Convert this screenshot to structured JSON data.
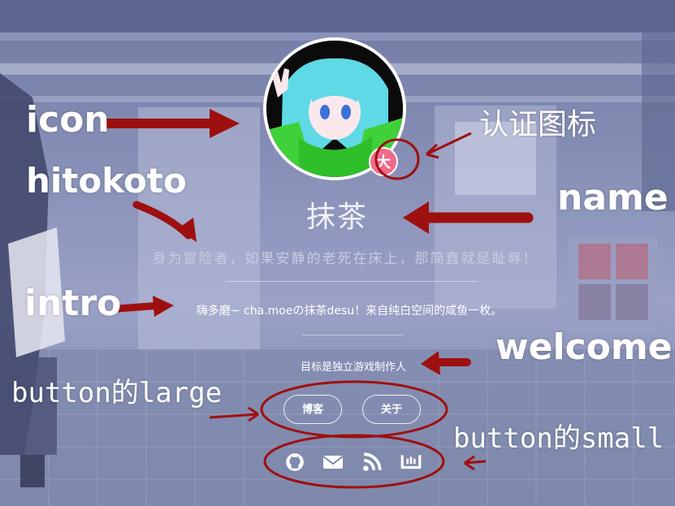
{
  "profile": {
    "name": "抹茶",
    "verify_badge": "大",
    "hitokoto": "身为冒险者，如果安静的老死在床上，那简直就是耻辱！",
    "intro": "嗨多磨~ cha.moeの抹茶desu！来自纯白空间的咸鱼一枚。",
    "welcome": "目标是独立游戏制作人"
  },
  "buttons_large": [
    {
      "label": "博客"
    },
    {
      "label": "关于"
    }
  ],
  "buttons_small": [
    {
      "icon": "github-icon"
    },
    {
      "icon": "mail-icon"
    },
    {
      "icon": "rss-icon"
    },
    {
      "icon": "bilibili-icon"
    }
  ],
  "annotations": {
    "icon": "icon",
    "hitokoto": "hitokoto",
    "intro": "intro",
    "verify": "认证图标",
    "name": "name",
    "welcome": "welcome",
    "button_large": "button的large",
    "button_small": "button的small"
  },
  "colors": {
    "annotation_red": "#9e1010",
    "verify_badge": "#ef6b8a"
  }
}
